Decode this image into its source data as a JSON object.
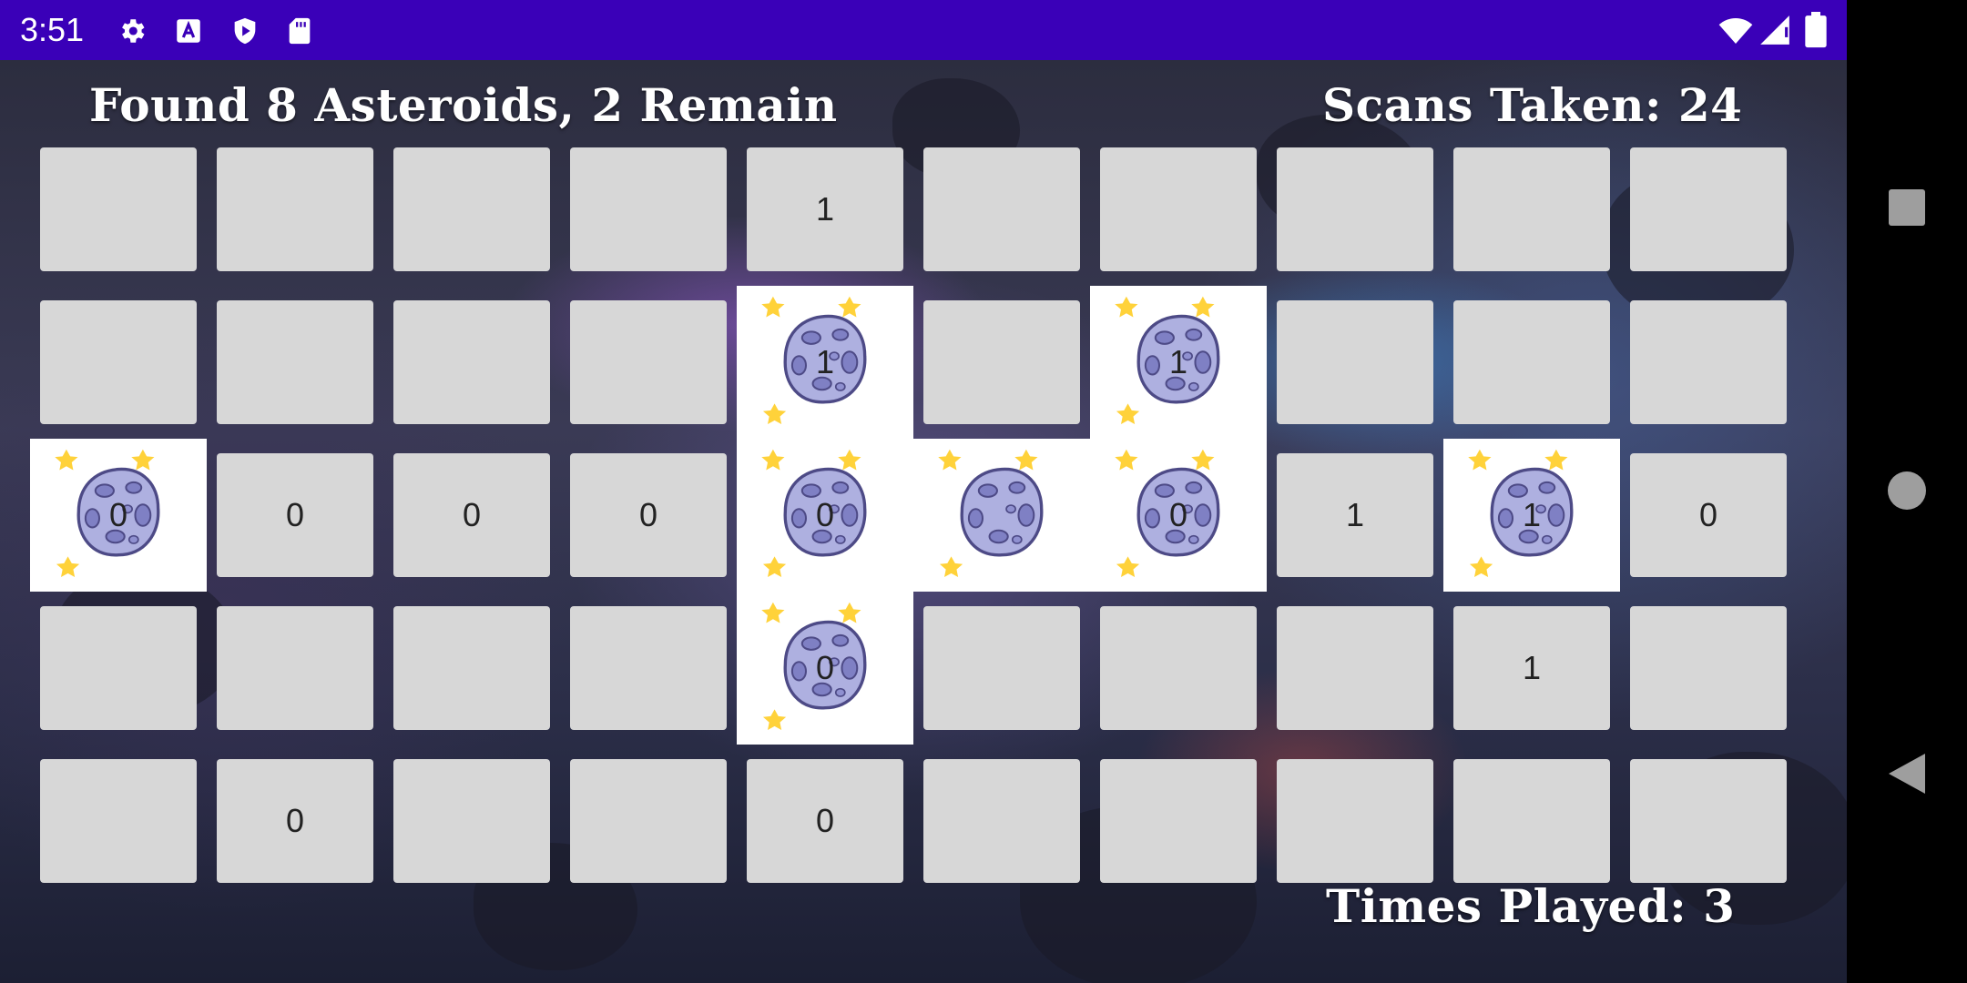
{
  "status_bar": {
    "time": "3:51",
    "left_icons": [
      "gear-icon",
      "a-letter-icon",
      "play-protect-icon",
      "sd-card-icon"
    ],
    "right_icons": [
      "wifi-icon",
      "cell-signal-icon",
      "battery-icon"
    ]
  },
  "hud": {
    "found_text": "Found 8 Asteroids, 2 Remain",
    "scans_text": "Scans Taken: 24",
    "played_text": "Times Played: 3"
  },
  "board": {
    "rows": 5,
    "cols": 10,
    "cells": [
      [
        "",
        "",
        "",
        "",
        "1",
        "",
        "",
        "",
        "",
        ""
      ],
      [
        "",
        "",
        "",
        "",
        "1",
        "",
        "1",
        "",
        "",
        ""
      ],
      [
        "0",
        "0",
        "0",
        "0",
        "0",
        "",
        "0",
        "1",
        "1",
        "0"
      ],
      [
        "",
        "",
        "",
        "",
        "0",
        "",
        "",
        "",
        "1",
        ""
      ],
      [
        "",
        "0",
        "",
        "",
        "0",
        "",
        "",
        "",
        "",
        ""
      ]
    ],
    "asteroids": [
      [
        1,
        4
      ],
      [
        1,
        6
      ],
      [
        2,
        0
      ],
      [
        2,
        4
      ],
      [
        2,
        5
      ],
      [
        2,
        6
      ],
      [
        2,
        8
      ],
      [
        3,
        4
      ]
    ]
  },
  "nav_bar": {
    "buttons": [
      "recents-button",
      "home-button",
      "back-button"
    ]
  },
  "colors": {
    "status_bar": "#3a00b8",
    "tile": "#d7d7d7",
    "revealed": "#ffffff",
    "asteroid": "#aeb0e0",
    "star": "#ffd23a"
  }
}
